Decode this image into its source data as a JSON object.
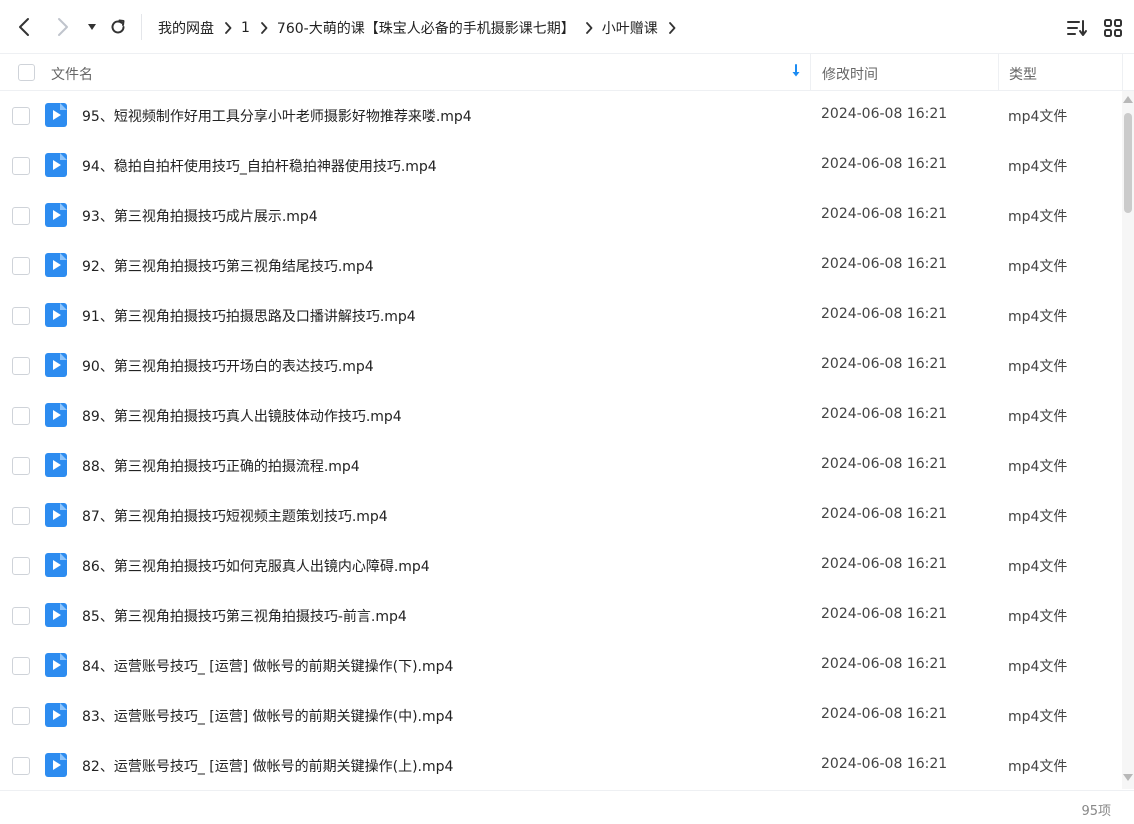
{
  "toolbar": {
    "icons": [
      "back-icon",
      "forward-icon",
      "history-dropdown-icon",
      "refresh-icon",
      "sort-icon",
      "grid-view-icon"
    ],
    "breadcrumb": [
      "我的网盘",
      "1",
      "760-大萌的课【珠宝人必备的手机摄影课七期】",
      "小叶赠课"
    ]
  },
  "header": {
    "name": "文件名",
    "time": "修改时间",
    "type": "类型"
  },
  "colors": {
    "accent": "#1c8cf3",
    "icon": "#2d8cf0"
  },
  "files": [
    {
      "name": "95、短视频制作好用工具分享小叶老师摄影好物推荐来喽.mp4",
      "time": "2024-06-08 16:21",
      "type": "mp4文件"
    },
    {
      "name": "94、稳拍自拍杆使用技巧_自拍杆稳拍神器使用技巧.mp4",
      "time": "2024-06-08 16:21",
      "type": "mp4文件"
    },
    {
      "name": "93、第三视角拍摄技巧成片展示.mp4",
      "time": "2024-06-08 16:21",
      "type": "mp4文件"
    },
    {
      "name": "92、第三视角拍摄技巧第三视角结尾技巧.mp4",
      "time": "2024-06-08 16:21",
      "type": "mp4文件"
    },
    {
      "name": "91、第三视角拍摄技巧拍摄思路及口播讲解技巧.mp4",
      "time": "2024-06-08 16:21",
      "type": "mp4文件"
    },
    {
      "name": "90、第三视角拍摄技巧开场白的表达技巧.mp4",
      "time": "2024-06-08 16:21",
      "type": "mp4文件"
    },
    {
      "name": "89、第三视角拍摄技巧真人出镜肢体动作技巧.mp4",
      "time": "2024-06-08 16:21",
      "type": "mp4文件"
    },
    {
      "name": "88、第三视角拍摄技巧正确的拍摄流程.mp4",
      "time": "2024-06-08 16:21",
      "type": "mp4文件"
    },
    {
      "name": "87、第三视角拍摄技巧短视频主题策划技巧.mp4",
      "time": "2024-06-08 16:21",
      "type": "mp4文件"
    },
    {
      "name": "86、第三视角拍摄技巧如何克服真人出镜内心障碍.mp4",
      "time": "2024-06-08 16:21",
      "type": "mp4文件"
    },
    {
      "name": "85、第三视角拍摄技巧第三视角拍摄技巧-前言.mp4",
      "time": "2024-06-08 16:21",
      "type": "mp4文件"
    },
    {
      "name": "84、运营账号技巧_ [运营] 做帐号的前期关键操作(下).mp4",
      "time": "2024-06-08 16:21",
      "type": "mp4文件"
    },
    {
      "name": "83、运营账号技巧_ [运营] 做帐号的前期关键操作(中).mp4",
      "time": "2024-06-08 16:21",
      "type": "mp4文件"
    },
    {
      "name": "82、运营账号技巧_ [运营] 做帐号的前期关键操作(上).mp4",
      "time": "2024-06-08 16:21",
      "type": "mp4文件"
    }
  ],
  "footer": {
    "count": "95项"
  }
}
